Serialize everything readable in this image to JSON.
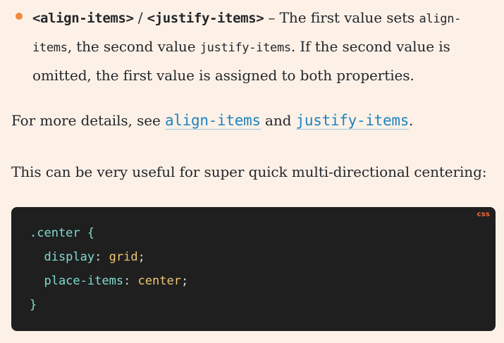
{
  "bullet": {
    "code_a": "<align-items>",
    "slash": " / ",
    "code_b": "<justify-items>",
    "dash_text": " – The first value sets ",
    "code_c": "align-items",
    "text_mid": ", the second value ",
    "code_d": "justify-items",
    "text_end": ". If the second value is omitted, the first value is assigned to both properties."
  },
  "details": {
    "prefix": "For more details, see ",
    "link_a": "align-items",
    "conj": " and ",
    "link_b": "justify-items",
    "suffix": "."
  },
  "useful": {
    "text": "This can be very useful for super quick multi-directional centering:"
  },
  "code": {
    "language": "css",
    "line1_selector": ".center",
    "line1_brace": " {",
    "line2_prop": "  display",
    "line2_colon": ": ",
    "line2_value": "grid",
    "line2_semi": ";",
    "line3_prop": "  place-items",
    "line3_colon": ": ",
    "line3_value": "center",
    "line3_semi": ";",
    "line4_brace": "}"
  },
  "colors": {
    "background": "#fdf1e7",
    "bullet": "#f08a3e",
    "link": "#1d84c0",
    "code_bg": "#1f1f1f",
    "lang_label": "#f06a3b"
  }
}
